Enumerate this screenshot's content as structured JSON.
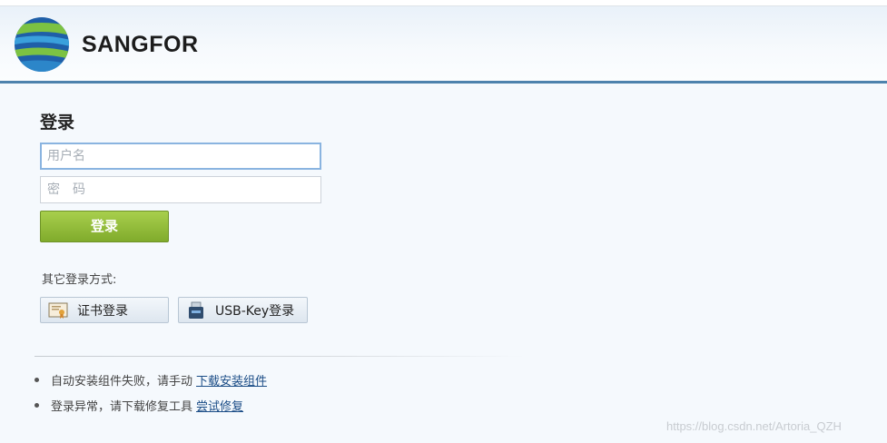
{
  "brand": {
    "name": "SANGFOR"
  },
  "login": {
    "title": "登录",
    "username_placeholder": "用户名",
    "password_placeholder": "密　码",
    "submit_label": "登录"
  },
  "alternatives": {
    "label": "其它登录方式:",
    "certificate_label": "证书登录",
    "usbkey_label": "USB-Key登录"
  },
  "tips": [
    {
      "text": "自动安装组件失败，请手动",
      "link": "下载安装组件"
    },
    {
      "text": "登录异常，请下载修复工具",
      "link": "尝试修复"
    }
  ],
  "watermark": "https://blog.csdn.net/Artoria_QZH",
  "colors": {
    "header_rule": "#4d82ad",
    "login_button": "#8fb838",
    "link": "#1a4c86"
  }
}
